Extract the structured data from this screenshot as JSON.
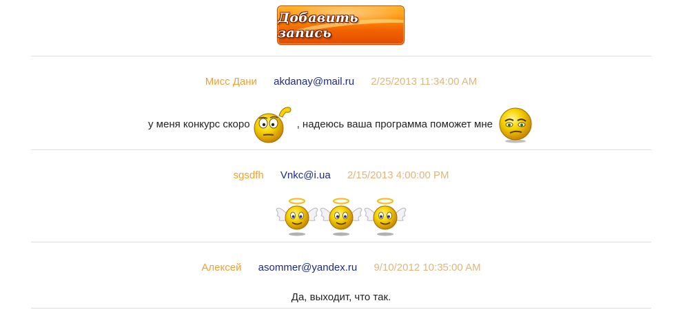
{
  "add_button": {
    "label": "Добавить запись"
  },
  "entries": [
    {
      "author": "Мисс Дани",
      "email": "akdanay@mail.ru",
      "date": "2/25/2013 11:34:00 AM",
      "text_before": "у меня конкурс скоро",
      "text_after": ", надеюсь ваша программа поможет мне",
      "emoticons": [
        "thinking-smiley-icon",
        "skeptical-smiley-icon"
      ]
    },
    {
      "author": "sgsdfh",
      "email": "Vnkc@i.ua",
      "date": "2/15/2013 4:00:00 PM",
      "emoticons": [
        "angel-smiley-icon",
        "angel-smiley-icon",
        "angel-smiley-icon"
      ]
    },
    {
      "author": "Алексей",
      "email": "asommer@yandex.ru",
      "date": "9/10/2012 10:35:00 AM",
      "text": "Да, выходит, что так."
    }
  ],
  "colors": {
    "author": "#f0a030",
    "email": "#1a2a8c",
    "date": "#e0b678",
    "button": "#f26400"
  }
}
